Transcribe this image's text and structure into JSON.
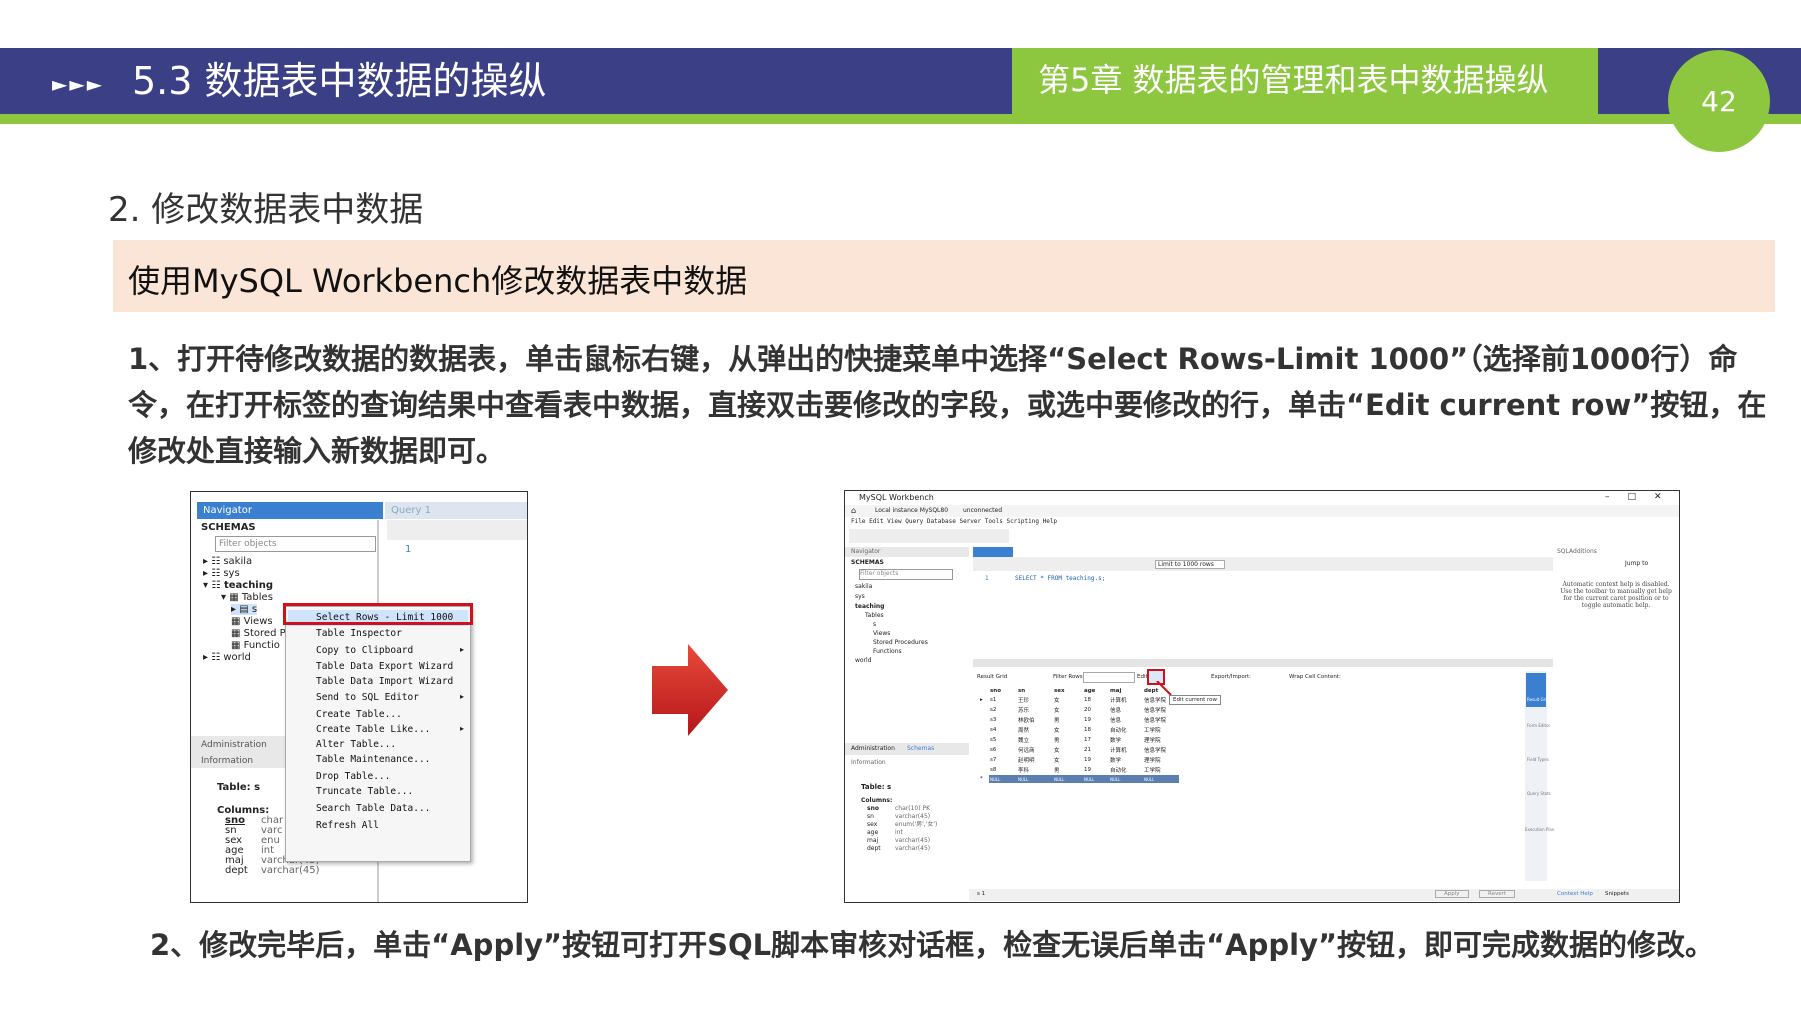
{
  "header": {
    "arrows": "►►►",
    "section_title": "5.3 数据表中数据的操纵",
    "chapter_title": "第5章 数据表的管理和表中数据操纵",
    "page_number": "42"
  },
  "content": {
    "subsection_title": "2. 修改数据表中数据",
    "band_text": "使用MySQL Workbench修改数据表中数据",
    "paragraph1": "1、打开待修改数据的数据表，单击鼠标右键，从弹出的快捷菜单中选择“Select Rows-Limit 1000”（选择前1000行）命令，在打开标签的查询结果中查看表中数据，直接双击要修改的字段，或选中要修改的行，单击“Edit current row”按钮，在修改处直接输入新数据即可。",
    "paragraph2": "2、修改完毕后，单击“Apply”按钮可打开SQL脚本审核对话框，检查无误后单击“Apply”按钮，即可完成数据的修改。"
  },
  "screenshot_left": {
    "navigator_title": "Navigator",
    "query_tab": "Query 1",
    "schemas_label": "SCHEMAS",
    "filter_placeholder": "Filter objects",
    "tree": [
      "sakila",
      "sys",
      "teaching",
      "Tables",
      "s",
      "Views",
      "Stored P",
      "Functio",
      "world"
    ],
    "editor_line": "1",
    "admin_tab": "Administration",
    "info_label": "Information",
    "table_label": "Table: s",
    "columns_label": "Columns:",
    "columns": [
      {
        "name": "sno",
        "type": "char"
      },
      {
        "name": "sn",
        "type": "varc"
      },
      {
        "name": "sex",
        "type": "enu"
      },
      {
        "name": "age",
        "type": "int"
      },
      {
        "name": "maj",
        "type": "varchar(45)"
      },
      {
        "name": "dept",
        "type": "varchar(45)"
      }
    ],
    "context_menu": [
      "Select Rows - Limit 1000",
      "Table Inspector",
      "Copy to Clipboard",
      "Table Data Export Wizard",
      "Table Data Import Wizard",
      "Send to SQL Editor",
      "Create Table...",
      "Create Table Like...",
      "Alter Table...",
      "Table Maintenance...",
      "Drop Table...",
      "Truncate Table...",
      "Search Table Data...",
      "Refresh All"
    ]
  },
  "screenshot_right": {
    "window_title": "MySQL Workbench",
    "tabs": [
      "Local instance MySQL80",
      "unconnected"
    ],
    "menu": [
      "File",
      "Edit",
      "View",
      "Query",
      "Database",
      "Server",
      "Tools",
      "Scripting",
      "Help"
    ],
    "navigator_label": "Navigator",
    "schemas_label": "SCHEMAS",
    "filter_placeholder": "Filter objects",
    "tree": [
      "sakila",
      "sys",
      "teaching",
      "Tables",
      "s",
      "Views",
      "Stored Procedures",
      "Functions",
      "world"
    ],
    "limit_select": "Limit to 1000 rows",
    "sql_line_no": "1",
    "sql_text": "SELECT * FROM teaching.s;",
    "result_grid_label": "Result Grid",
    "filter_rows_label": "Filter Rows:",
    "edit_label": "Edit:",
    "export_label": "Export/Import:",
    "wrap_label": "Wrap Cell Content:",
    "tooltip": "Edit current row",
    "grid_headers": [
      "sno",
      "sn",
      "sex",
      "age",
      "maj",
      "dept"
    ],
    "grid_rows": [
      [
        "s1",
        "王珍",
        "女",
        "18",
        "计算机",
        "信息学院"
      ],
      [
        "s2",
        "苏乐",
        "女",
        "20",
        "信息",
        "信息学院"
      ],
      [
        "s3",
        "林欧伯",
        "男",
        "19",
        "信息",
        "信息学院"
      ],
      [
        "s4",
        "周然",
        "女",
        "18",
        "自动化",
        "工学院"
      ],
      [
        "s5",
        "魏立",
        "男",
        "17",
        "数学",
        "理学院"
      ],
      [
        "s6",
        "何远商",
        "女",
        "21",
        "计算机",
        "信息学院"
      ],
      [
        "s7",
        "赵明明",
        "女",
        "19",
        "数学",
        "理学院"
      ],
      [
        "s8",
        "李科",
        "男",
        "19",
        "自动化",
        "工学院"
      ]
    ],
    "null_cell": "NULL",
    "sql_additions_label": "SQLAdditions",
    "jump_to": "Jump to",
    "help_text": "Automatic context help is disabled. Use the toolbar to manually get help for the current caret position or to toggle automatic help.",
    "side_tabs": [
      "Result Grid",
      "Form Editor",
      "Field Types",
      "Query Stats",
      "Execution Plan"
    ],
    "admin_tab": "Administration",
    "schemas_tab": "Schemas",
    "info_label": "Information",
    "table_label": "Table: s",
    "columns_label": "Columns:",
    "columns": [
      {
        "name": "sno",
        "type": "char(10) PK"
      },
      {
        "name": "sn",
        "type": "varchar(45)"
      },
      {
        "name": "sex",
        "type": "enum('男','女')"
      },
      {
        "name": "age",
        "type": "int"
      },
      {
        "name": "maj",
        "type": "varchar(45)"
      },
      {
        "name": "dept",
        "type": "varchar(45)"
      }
    ],
    "result_tab": "s 1",
    "apply_button": "Apply",
    "revert_button": "Revert",
    "bottom_tabs": [
      "Context Help",
      "Snippets"
    ]
  }
}
